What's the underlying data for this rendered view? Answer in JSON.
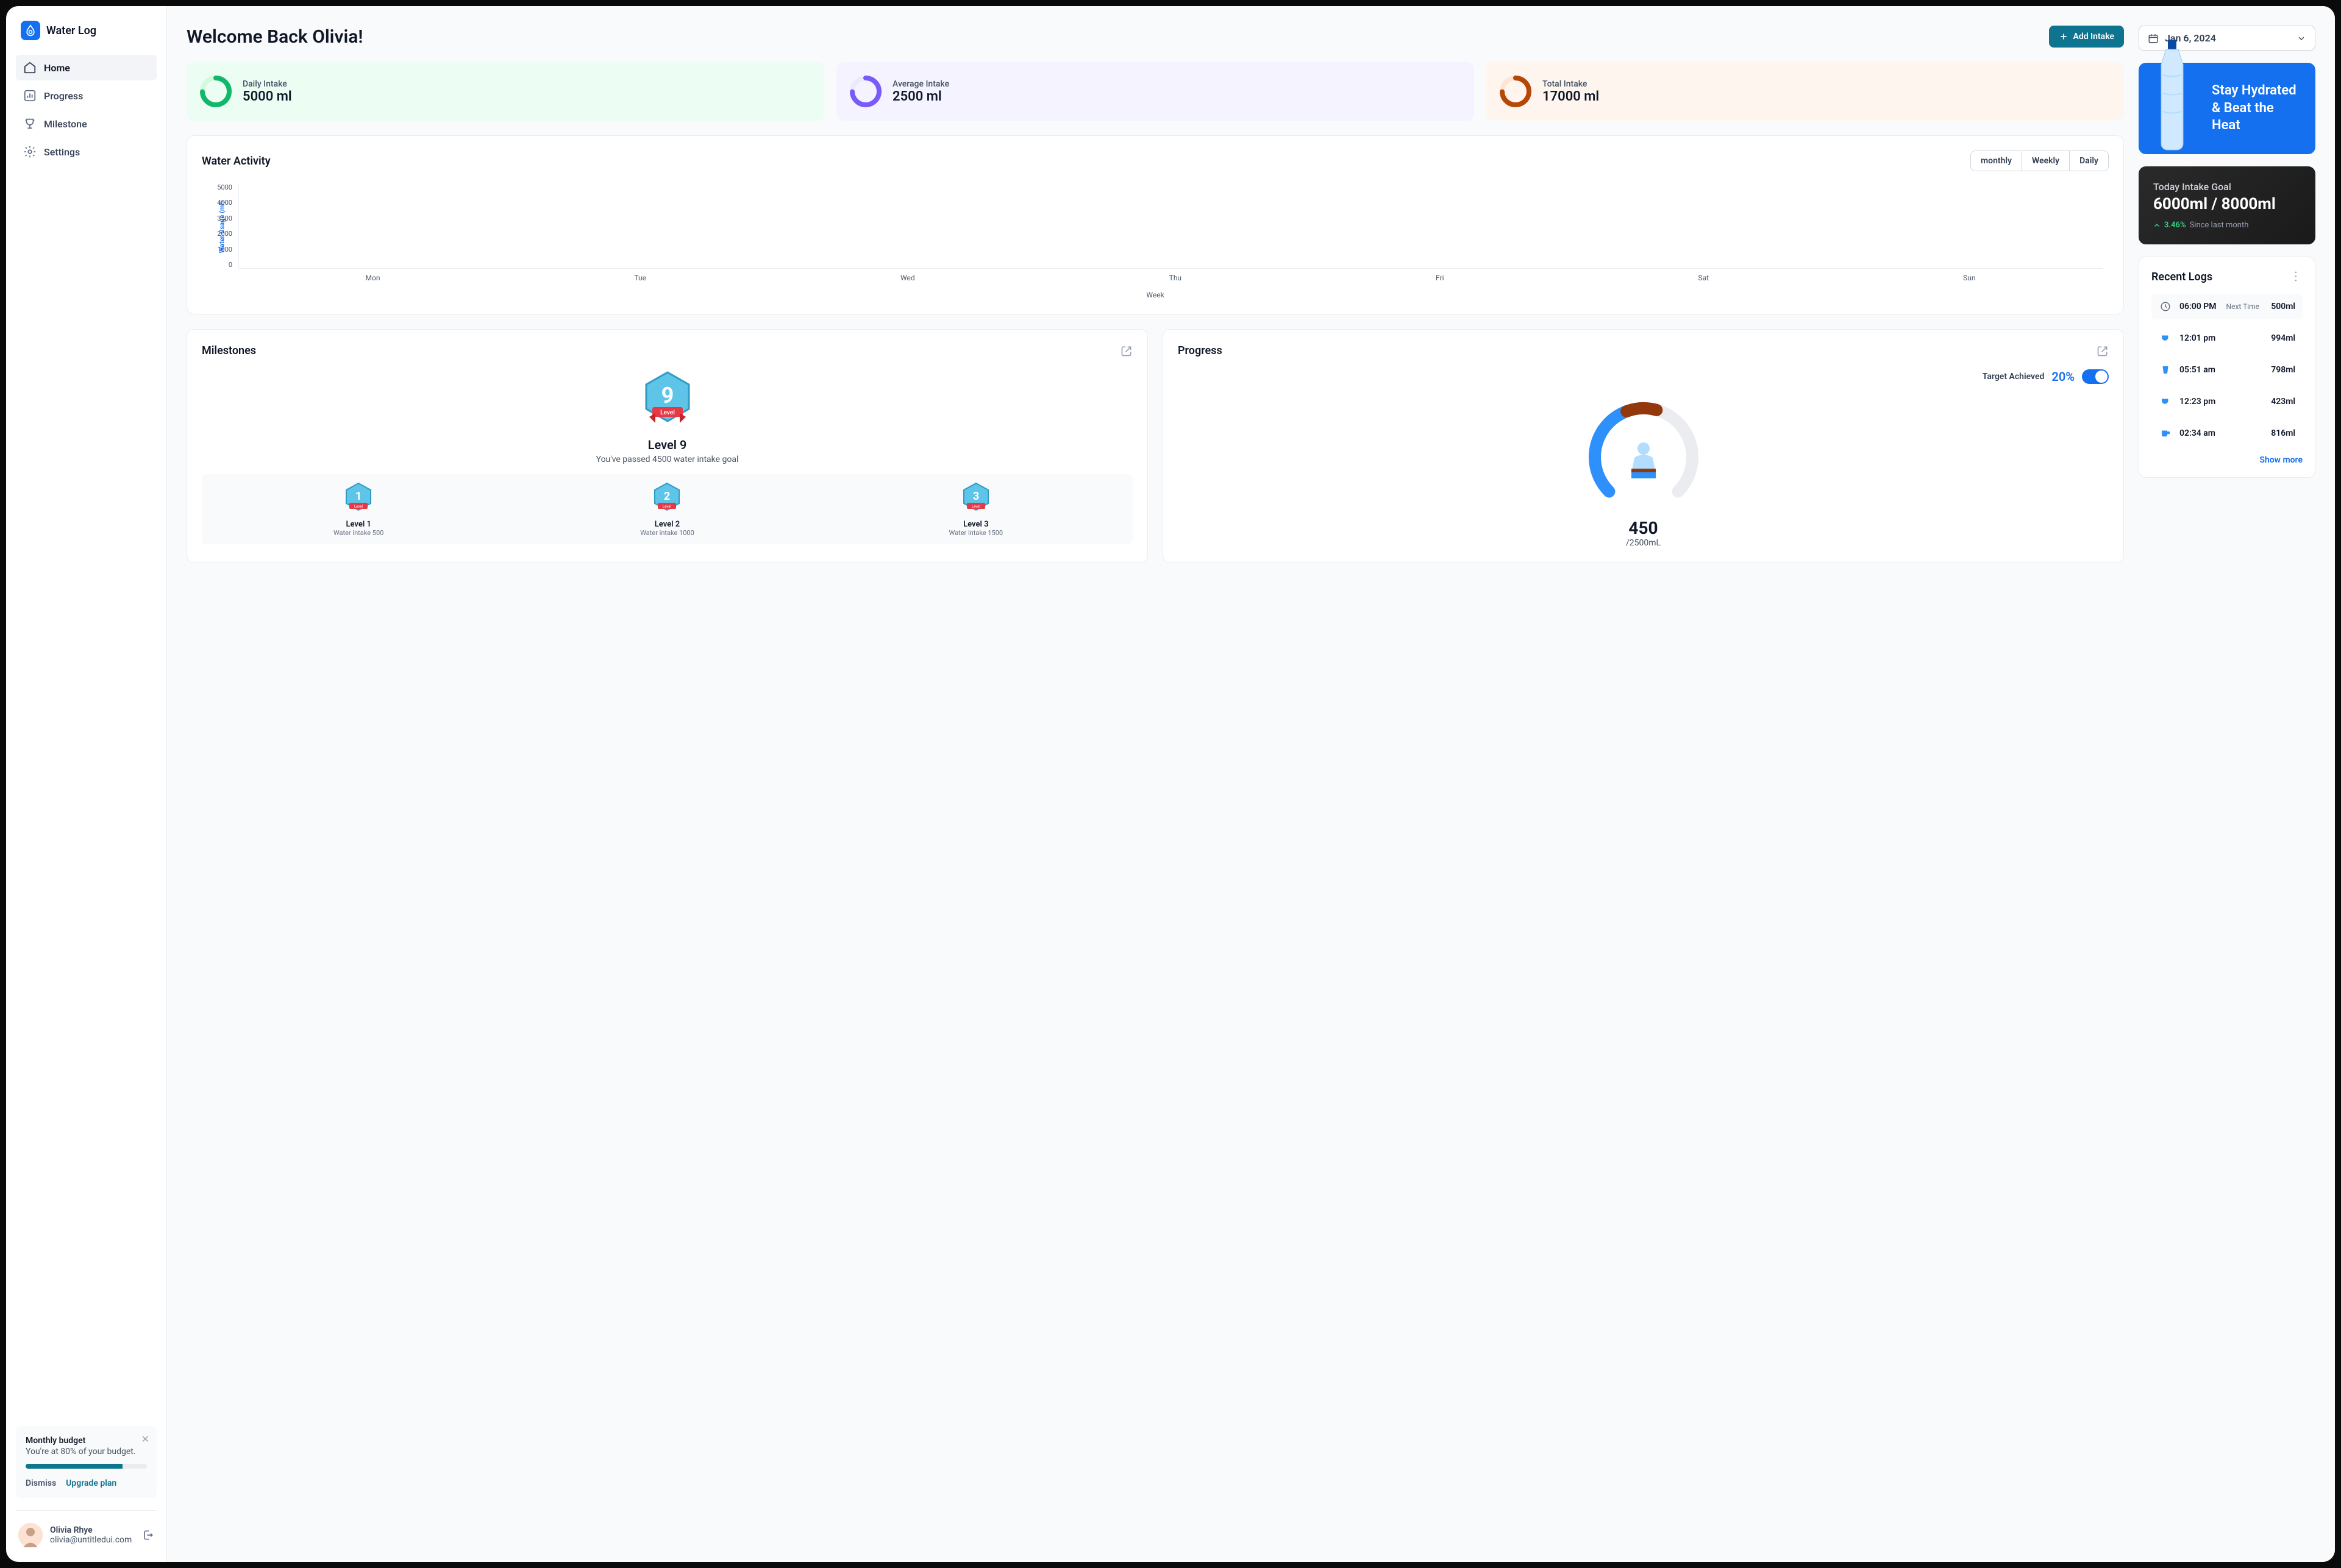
{
  "app": {
    "name": "Water Log"
  },
  "nav": {
    "items": [
      {
        "label": "Home",
        "icon": "home",
        "active": true
      },
      {
        "label": "Progress",
        "icon": "bar-chart",
        "active": false
      },
      {
        "label": "Milestone",
        "icon": "trophy",
        "active": false
      },
      {
        "label": "Settings",
        "icon": "gear",
        "active": false
      }
    ]
  },
  "budget": {
    "title": "Monthly budget",
    "subtitle": "You're at 80% of your budget.",
    "percent": 80,
    "dismiss": "Dismiss",
    "upgrade": "Upgrade plan"
  },
  "user": {
    "name": "Olivia Rhye",
    "email": "olivia@untitledui.com"
  },
  "header": {
    "title": "Welcome Back Olivia!",
    "addButton": "Add Intake"
  },
  "stats": [
    {
      "label": "Daily Intake",
      "value": "5000 ml",
      "color": "green",
      "ring": "#12b76a"
    },
    {
      "label": "Average Intake",
      "value": "2500 ml",
      "color": "purple",
      "ring": "#7a5af8"
    },
    {
      "label": "Total Intake",
      "value": "17000 ml",
      "color": "orange",
      "ring": "#b54708"
    }
  ],
  "chart": {
    "title": "Water Activity",
    "tabs": [
      "monthly",
      "Weekly",
      "Daily"
    ],
    "ylabel": "Water Usage (ml)",
    "xlabel": "Week"
  },
  "chart_data": {
    "type": "line",
    "categories": [
      "Mon",
      "Tue",
      "Wed",
      "Thu",
      "Fri",
      "Sat",
      "Sun"
    ],
    "values": [
      null,
      null,
      null,
      null,
      null,
      null,
      null
    ],
    "y_ticks": [
      5000,
      4000,
      3500,
      2000,
      1000,
      0
    ],
    "title": "Water Activity",
    "xlabel": "Week",
    "ylabel": "Water Usage (ml)",
    "ylim": [
      0,
      5000
    ]
  },
  "milestones": {
    "title": "Milestones",
    "mainLevel": "Level 9",
    "mainSub": "You've passed 4500 water intake goal",
    "badges": [
      {
        "title": "Level 1",
        "sub": "Water intake 500"
      },
      {
        "title": "Level 2",
        "sub": "Water intake 1000"
      },
      {
        "title": "Level 3",
        "sub": "Water intake 1500"
      }
    ]
  },
  "progress": {
    "title": "Progress",
    "target": "Target Achieved",
    "pct": "20%",
    "value": "450",
    "total": "/2500mL"
  },
  "date": {
    "label": "Jan 6, 2024"
  },
  "hydrate": {
    "text": "Stay Hydrated & Beat the Heat"
  },
  "goal": {
    "label": "Today Intake Goal",
    "value": "6000ml / 8000ml",
    "pct": "3.46%",
    "since": "Since last month"
  },
  "logs": {
    "title": "Recent Logs",
    "showMore": "Show more",
    "items": [
      {
        "time": "06:00 PM",
        "sub": "Next Time",
        "amount": "500ml",
        "icon": "clock"
      },
      {
        "time": "12:01 pm",
        "sub": "",
        "amount": "994ml",
        "icon": "cup"
      },
      {
        "time": "05:51 am",
        "sub": "",
        "amount": "798ml",
        "icon": "glass"
      },
      {
        "time": "12:23 pm",
        "sub": "",
        "amount": "423ml",
        "icon": "cup"
      },
      {
        "time": "02:34 am",
        "sub": "",
        "amount": "816ml",
        "icon": "mug"
      }
    ]
  }
}
